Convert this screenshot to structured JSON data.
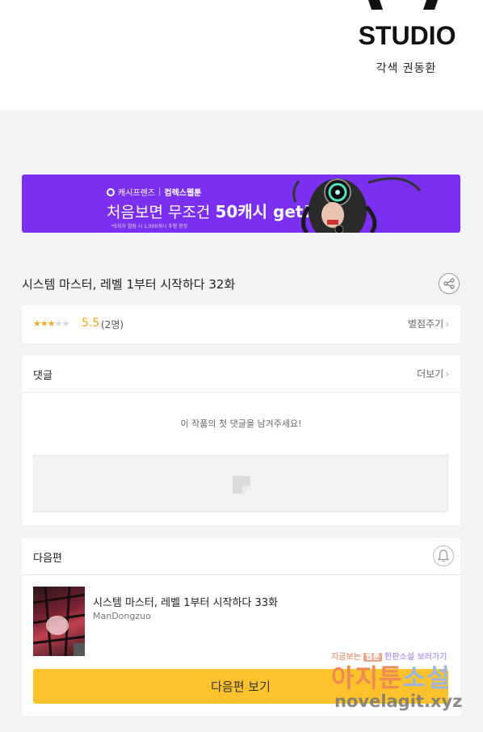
{
  "studio": {
    "logo_text": "STUDIO",
    "credit": "각색 권동환"
  },
  "banner": {
    "brand1": "캐시프렌즈",
    "brand_sep": "|",
    "brand2": "컴렉스웹툰",
    "headline_pre": "처음보면 무조건 ",
    "headline_big": "50캐시 get!!",
    "note": "*5회차 열람 시 1,000캐시 추첨 증정",
    "color": "#7b2ff0"
  },
  "episode": {
    "title": "시스템 마스터, 레벨 1부터 시작하다 32화",
    "share_icon": "share-icon"
  },
  "rating": {
    "stars_filled": 3,
    "stars_total": 5,
    "score": "5.5",
    "count": "(2명)",
    "rate_label": "별점주기",
    "star_color": "#f5a623"
  },
  "comments": {
    "title": "댓글",
    "more_label": "더보기",
    "empty_text": "이 작품의 첫 댓글을 남겨주세요!"
  },
  "next": {
    "section_title": "다음편",
    "episode_title": "시스템 마스터, 레벨 1부터 시작하다 33화",
    "author": "ManDongzuo",
    "button_label": "다음편 보기",
    "button_color": "#fdc22c"
  },
  "watermark": {
    "top_a": "지금보는 ",
    "top_b": "웹툰",
    "top_c": " 한판소설 보러가기",
    "main1": "아지툰",
    "main2": "소설",
    "url": "novelagit.xyz"
  }
}
